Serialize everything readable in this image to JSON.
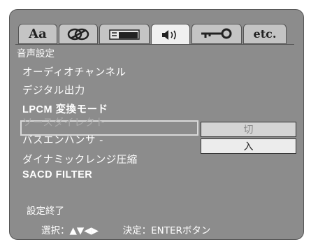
{
  "tabs": [
    {
      "label": "Aa",
      "icon": "language-icon"
    },
    {
      "label": "",
      "icon": "picture-icon"
    },
    {
      "label": "",
      "icon": "display-icon"
    },
    {
      "label": "",
      "icon": "audio-icon"
    },
    {
      "label": "",
      "icon": "key-icon"
    },
    {
      "label": "etc.",
      "icon": "etc-icon"
    }
  ],
  "active_tab": 3,
  "title": "音声設定",
  "menu": [
    {
      "label": "オーディオチャンネル",
      "style": "normal"
    },
    {
      "label": "デジタル出力",
      "style": "normal"
    },
    {
      "label": "LPCM 変換モード",
      "style": "bold"
    },
    {
      "label": "ソースダイレクト",
      "style": "disabled"
    },
    {
      "label": "バスエンハンサ -",
      "style": "normal"
    },
    {
      "label": "ダイナミックレンジ圧縮",
      "style": "normal"
    },
    {
      "label": "SACD FILTER",
      "style": "bold"
    }
  ],
  "options": {
    "off": "切",
    "on": "入"
  },
  "end_label": "設定終了",
  "hint": {
    "select": "選択：▲▼◀▶",
    "confirm": "決定：ENTERボタン"
  },
  "colors": {
    "panel": "#8c8c8c",
    "tab": "#c4c4c4",
    "highlight_border": "#d9d9d9"
  }
}
